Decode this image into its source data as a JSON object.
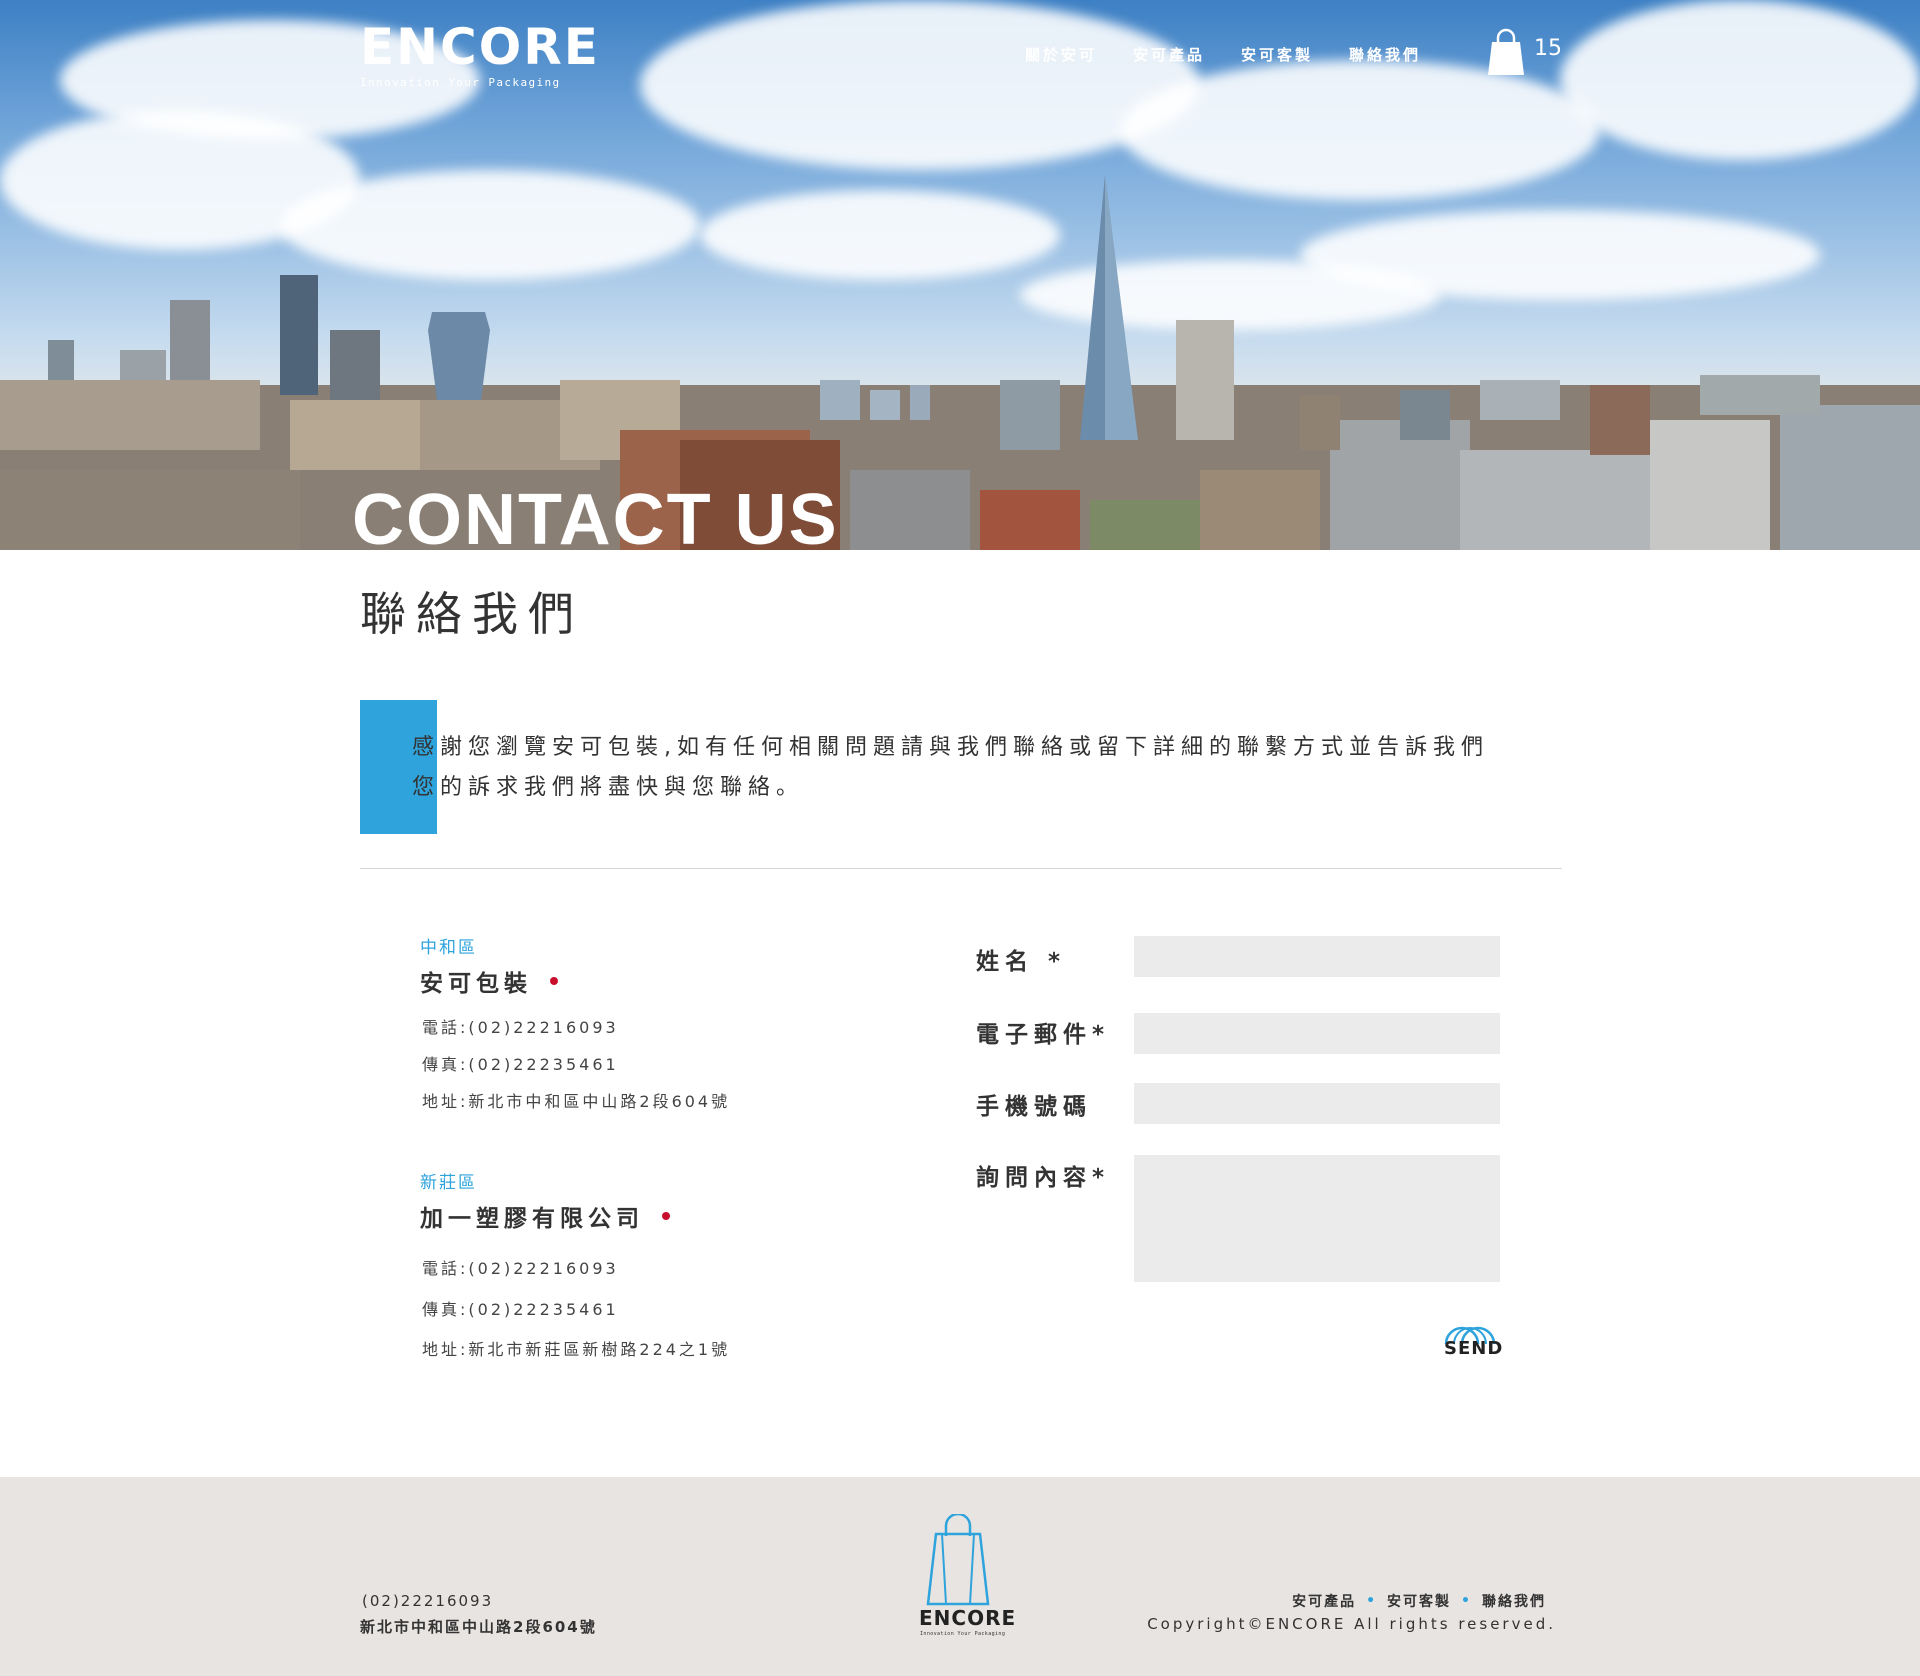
{
  "header": {
    "logo_text": "ENCORE",
    "logo_tagline": "Innovation Your Packaging",
    "nav": [
      "關於安可",
      "安可產品",
      "安可客製",
      "聯絡我們"
    ],
    "cart_count": "15"
  },
  "hero": {
    "title": "CONTACT US"
  },
  "page_title": "聯絡我們",
  "intro": "感謝您瀏覽安可包裝,如有任何相關問題請與我們聯絡或留下詳細的聯繫方式並告訴我們您的訴求我們將盡快與您聯絡。",
  "offices": [
    {
      "area": "中和區",
      "company": "安可包裝",
      "phone": "電話:(02)22216093",
      "fax": "傳真:(02)22235461",
      "address": "地址:新北市中和區中山路2段604號"
    },
    {
      "area": "新莊區",
      "company": "加一塑膠有限公司",
      "phone": "電話:(02)22216093",
      "fax": "傳真:(02)22235461",
      "address": "地址:新北市新莊區新樹路224之1號"
    }
  ],
  "form": {
    "name_label": "姓名 *",
    "email_label": "電子郵件*",
    "mobile_label": "手機號碼",
    "message_label": "詢問內容*",
    "name_value": "",
    "email_value": "",
    "mobile_value": "",
    "message_value": "",
    "send_label": "SEND"
  },
  "footer": {
    "phone": "(02)22216093",
    "address": "新北市中和區中山路2段604號",
    "logo_text": "ENCORE",
    "logo_tagline": "Innovation Your Packaging",
    "links": [
      "安可產品",
      "安可客製",
      "聯絡我們"
    ],
    "copyright": "Copyright©ENCORE All rights reserved."
  },
  "colors": {
    "accent": "#2ea3dc",
    "brand_red": "#c8102e",
    "footer_bg": "#e8e4e2",
    "input_bg": "#ebebeb"
  }
}
